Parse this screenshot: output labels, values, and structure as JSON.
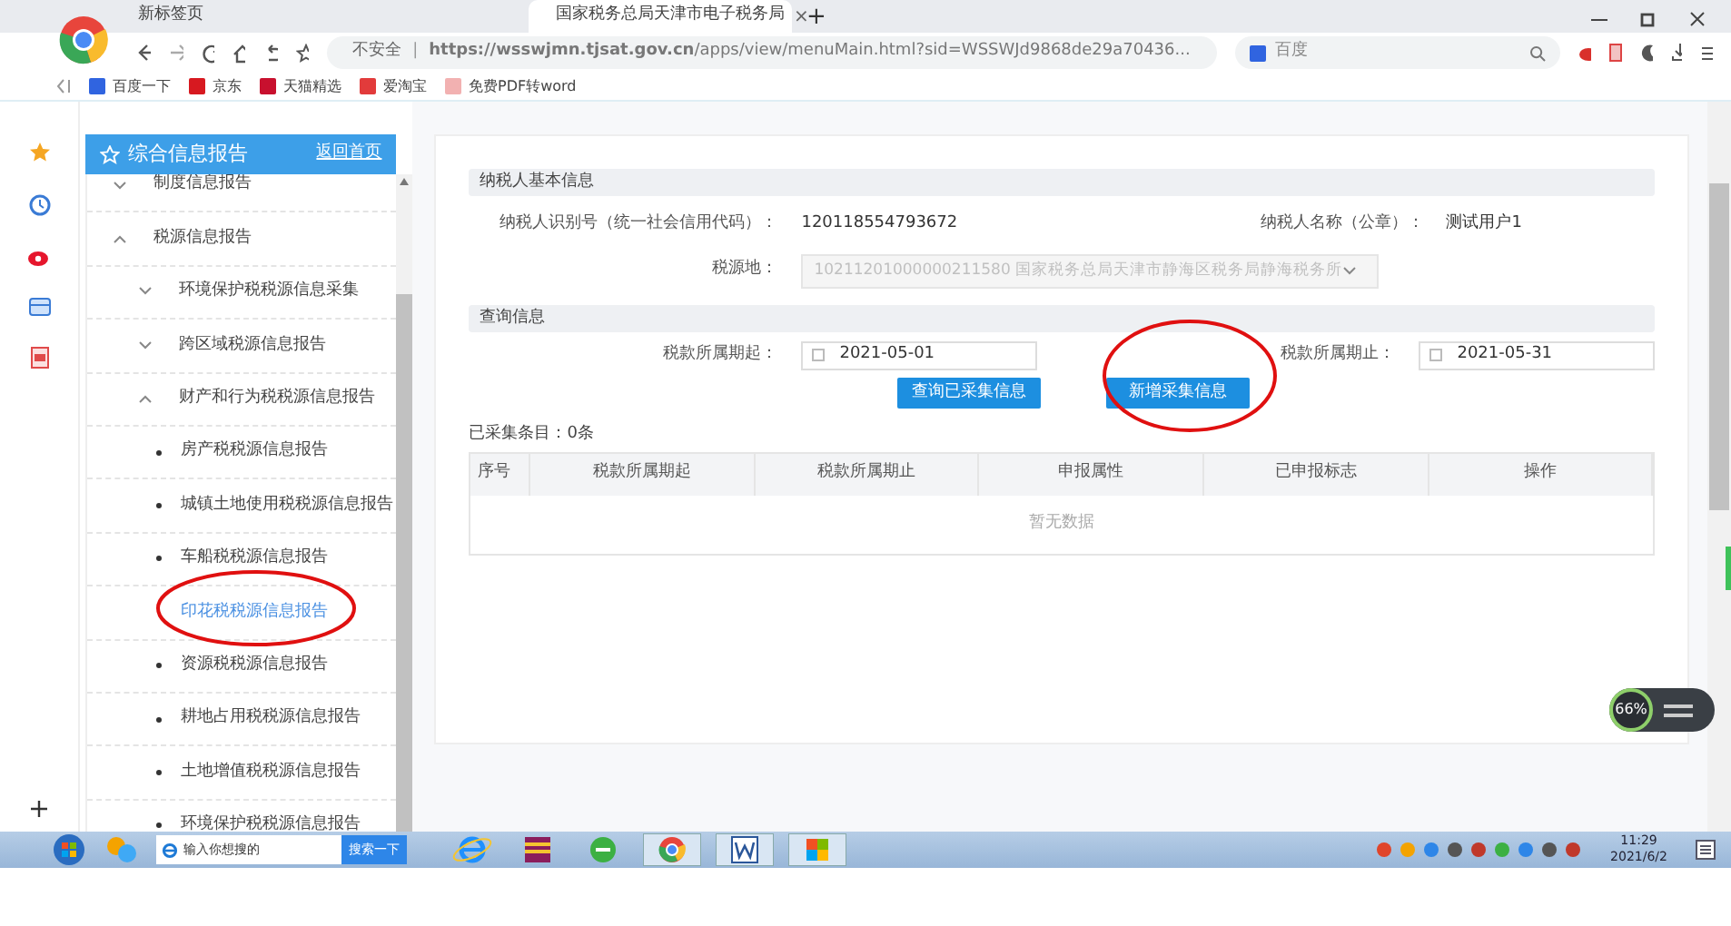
{
  "browser": {
    "tabs": [
      {
        "title": "新标签页",
        "selected": false
      },
      {
        "title": "国家税务总局天津市电子税务局",
        "selected": true,
        "close": "×"
      }
    ],
    "new_tab": "+",
    "address": {
      "warning": "不安全",
      "separator": "|",
      "url": "**https://wsswjmn.tjsat.gov.cn**/apps/view/menuMain.html?sid=WSSWJd9868de29a70436..."
    },
    "search": {
      "placeholder": "百度"
    },
    "bookmarks": [
      "百度一下",
      "京东",
      "天猫精选",
      "爱淘宝",
      "免费PDF转word"
    ]
  },
  "sidebar": {
    "title": "综合信息报告",
    "home_link": "返回首页",
    "items": [
      {
        "label": "制度信息报告",
        "expanded": false
      },
      {
        "label": "税源信息报告",
        "expanded": true,
        "children": [
          {
            "label": "环境保护税税源信息采集",
            "expanded": false
          },
          {
            "label": "跨区域税源信息报告",
            "expanded": false
          },
          {
            "label": "财产和行为税税源信息报告",
            "expanded": true,
            "children": [
              {
                "label": "房产税税源信息报告",
                "selected": false
              },
              {
                "label": "城镇土地使用税税源信息报告",
                "selected": false
              },
              {
                "label": "车船税税源信息报告",
                "selected": false
              },
              {
                "label": "印花税税源信息报告",
                "selected": true
              },
              {
                "label": "资源税税源信息报告",
                "selected": false
              },
              {
                "label": "耕地占用税税源信息报告",
                "selected": false
              },
              {
                "label": "土地增值税税源信息报告",
                "selected": false
              },
              {
                "label": "环境保护税税源信息报告",
                "selected": false
              }
            ]
          }
        ]
      }
    ]
  },
  "taxpayer": {
    "title": "纳税人基本信息",
    "id_label": "纳税人识别号（统一社会信用代码）：",
    "id_value": "120118554793672",
    "name_label": "纳税人名称（公章）：",
    "name_value": "测试用户1",
    "source_label": "税源地：",
    "source_value": "10211201000000211580 国家税务总局天津市静海区税务局静海税务所"
  },
  "query": {
    "title": "查询信息",
    "start_label": "税款所属期起：",
    "start_value": "2021-05-01",
    "end_label": "税款所属期止：",
    "end_value": "2021-05-31",
    "buttons": [
      "查询已采集信息",
      "新增采集信息"
    ]
  },
  "table": {
    "count": "已采集条目：0条",
    "columns": [
      "序号",
      "税款所属期起",
      "税款所属期止",
      "申报属性",
      "已申报标志",
      "操作"
    ],
    "empty": "暂无数据"
  },
  "speed_widget": {
    "percent": "66%"
  },
  "taskbar": {
    "search_placeholder": "输入你想搜的",
    "search_button": "搜索一下",
    "time": "11:29",
    "date": "2021/6/2"
  }
}
